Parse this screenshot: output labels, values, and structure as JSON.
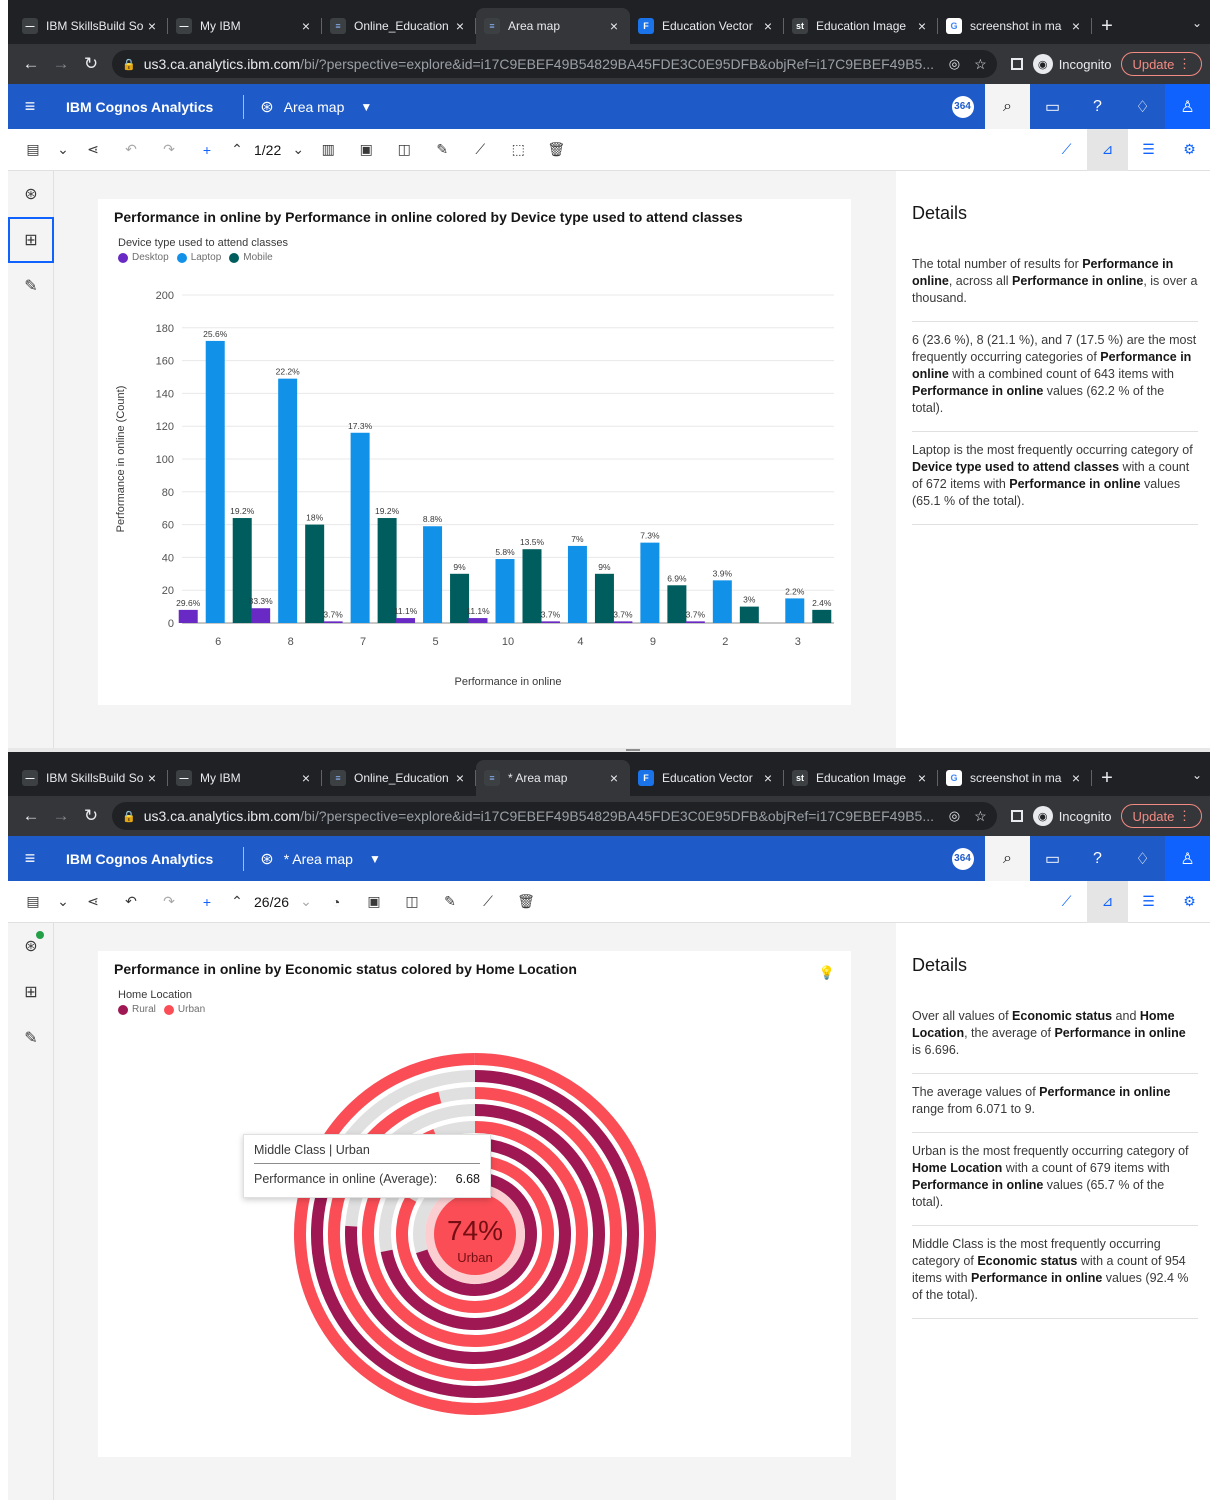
{
  "browser": {
    "tabs": [
      "IBM SkillsBuild So",
      "My IBM",
      "Online_Education",
      "Area map",
      "Education Vector",
      "Education Image",
      "screenshot in ma"
    ],
    "tabs2": [
      "IBM SkillsBuild So",
      "My IBM",
      "Online_Education",
      "* Area map",
      "Education Vector",
      "Education Image",
      "screenshot in ma"
    ],
    "new_tab": "+",
    "url_host": "us3.ca.analytics.ibm.com",
    "url_path": "/bi/?perspective=explore&id=i17C9EBEF49B54829BA45FDE3C0E95DFB&objRef=i17C9EBEF49B5...",
    "incognito": "Incognito",
    "update": "Update"
  },
  "app": {
    "name": "IBM Cognos Analytics",
    "view1": "Area map",
    "view2": "* Area map",
    "badge": "364"
  },
  "toolbar": {
    "pager1": "1/22",
    "pager2": "26/26"
  },
  "chart1": {
    "title": "Performance in online by Performance in online colored by Device type used to attend classes",
    "legend_title": "Device type used to attend classes",
    "legend": [
      "Desktop",
      "Laptop",
      "Mobile"
    ],
    "details_title": "Details",
    "details": [
      [
        "The total number of results for ",
        "Performance in online",
        ", across all ",
        "Performance in online",
        ", is over a thousand."
      ],
      [
        "6 (23.6 %), 8 (21.1 %), and 7 (17.5 %) are the most frequently occurring categories of ",
        "Performance in online",
        " with a combined count of 643 items with ",
        "Performance in online",
        " values (62.2 % of the total)."
      ],
      [
        "Laptop is the most frequently occurring category of ",
        "Device type used to attend classes",
        " with a count of 672 items with ",
        "Performance in online",
        " values (65.1 % of the total)."
      ]
    ]
  },
  "chart2": {
    "title": "Performance in online by Economic status colored by Home Location",
    "legend_title": "Home Location",
    "legend": [
      "Rural",
      "Urban"
    ],
    "center_value": "74%",
    "center_label": "Urban",
    "tooltip_title": "Middle Class | Urban",
    "tooltip_label": "Performance in online (Average):",
    "tooltip_value": "6.68",
    "details_title": "Details",
    "details": [
      [
        "Over all values of ",
        "Economic status",
        " and ",
        "Home Location",
        ", the average of ",
        "Performance in online",
        " is 6.696."
      ],
      [
        "The average values of ",
        "Performance in online",
        " range from 6.071 to 9."
      ],
      [
        "Urban is the most frequently occurring category of ",
        "Home Location",
        " with a count of 679 items with ",
        "Performance in online",
        " values (65.7 % of the total)."
      ],
      [
        "Middle Class is the most frequently occurring category of ",
        "Economic status",
        " with a count of 954 items with ",
        "Performance in online",
        " values (92.4 % of the total)."
      ]
    ]
  },
  "colors": {
    "desktop": "#6929c4",
    "laptop": "#1192e8",
    "mobile": "#005d5d",
    "rural": "#9f1853",
    "urban": "#fa4d56",
    "track": "#e0e0e0",
    "brand": "#1f5bc8"
  },
  "chart_data": [
    {
      "type": "bar",
      "title": "Performance in online by Performance in online colored by Device type used to attend classes",
      "xlabel": "Performance in online",
      "ylabel": "Performance in online (Count)",
      "ylim": [
        0,
        200
      ],
      "yticks": [
        0,
        20,
        40,
        60,
        80,
        100,
        120,
        140,
        160,
        180,
        200
      ],
      "legend_title": "Device type used to attend classes",
      "legend_position": "top-left",
      "grid": "horizontal",
      "categories": [
        "6",
        "8",
        "7",
        "5",
        "10",
        "4",
        "9",
        "2",
        "3"
      ],
      "series": [
        {
          "name": "Desktop",
          "values": [
            8,
            9,
            1,
            3,
            3,
            1,
            1,
            1,
            0
          ],
          "labels": [
            "29.6%",
            "33.3%",
            "3.7%",
            "11.1%",
            "11.1%",
            "3.7%",
            "3.7%",
            "3.7%",
            ""
          ]
        },
        {
          "name": "Laptop",
          "values": [
            172,
            149,
            116,
            59,
            39,
            47,
            49,
            26,
            15
          ],
          "labels": [
            "25.6%",
            "22.2%",
            "17.3%",
            "8.8%",
            "5.8%",
            "7%",
            "7.3%",
            "3.9%",
            "2.2%"
          ]
        },
        {
          "name": "Mobile",
          "values": [
            64,
            60,
            64,
            30,
            45,
            30,
            23,
            10,
            8
          ],
          "labels": [
            "19.2%",
            "18%",
            "19.2%",
            "9%",
            "13.5%",
            "9%",
            "6.9%",
            "3%",
            "2.4%"
          ]
        }
      ]
    },
    {
      "type": "radial-bar",
      "title": "Performance in online by Economic status colored by Home Location",
      "legend_title": "Home Location",
      "legend_position": "top-left",
      "series": [
        {
          "name": "Rural",
          "values": [
            0.82,
            0.76,
            0.72,
            0.7
          ]
        },
        {
          "name": "Urban",
          "values": [
            1.0,
            0.96,
            0.94,
            0.83
          ]
        }
      ],
      "center_value": "74%",
      "center_label": "Urban",
      "tooltip": {
        "category": "Middle Class | Urban",
        "measure": "Performance in online (Average)",
        "value": 6.68
      }
    }
  ]
}
